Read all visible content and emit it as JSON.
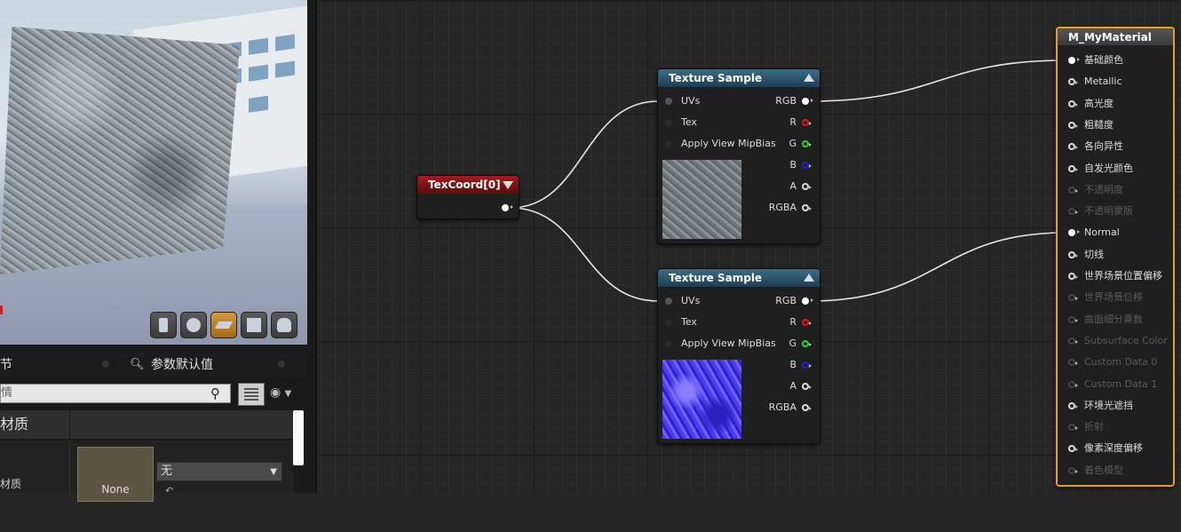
{
  "details_panel": {
    "tab_details": "节",
    "tab_params": "参数默认值",
    "search_placeholder": "情",
    "section_material": "材质",
    "prop_label": "材质",
    "thumb_label": "None",
    "combo_value": "无"
  },
  "graph": {
    "texcoord": {
      "title": "TexCoord[0]"
    },
    "ts1": {
      "title": "Texture Sample",
      "inputs": [
        "UVs",
        "Tex",
        "Apply View MipBias"
      ],
      "outputs": [
        "RGB",
        "R",
        "G",
        "B",
        "A",
        "RGBA"
      ]
    },
    "ts2": {
      "title": "Texture Sample",
      "inputs": [
        "UVs",
        "Tex",
        "Apply View MipBias"
      ],
      "outputs": [
        "RGB",
        "R",
        "G",
        "B",
        "A",
        "RGBA"
      ]
    },
    "material": {
      "title": "M_MyMaterial",
      "pins": [
        "基础颜色",
        "Metallic",
        "高光度",
        "粗糙度",
        "各向异性",
        "自发光颜色",
        "不透明度",
        "不透明蒙版",
        "Normal",
        "切线",
        "世界场景位置偏移",
        "世界场景位移",
        "曲面细分乘数",
        "Subsurface Color",
        "Custom Data 0",
        "Custom Data 1",
        "环境光遮挡",
        "折射",
        "像素深度偏移",
        "着色模型"
      ]
    }
  },
  "colors": {
    "accent_orange": "#e8a020",
    "texcoord_header": "#a11d1d",
    "texture_header": "#3c6c88"
  }
}
